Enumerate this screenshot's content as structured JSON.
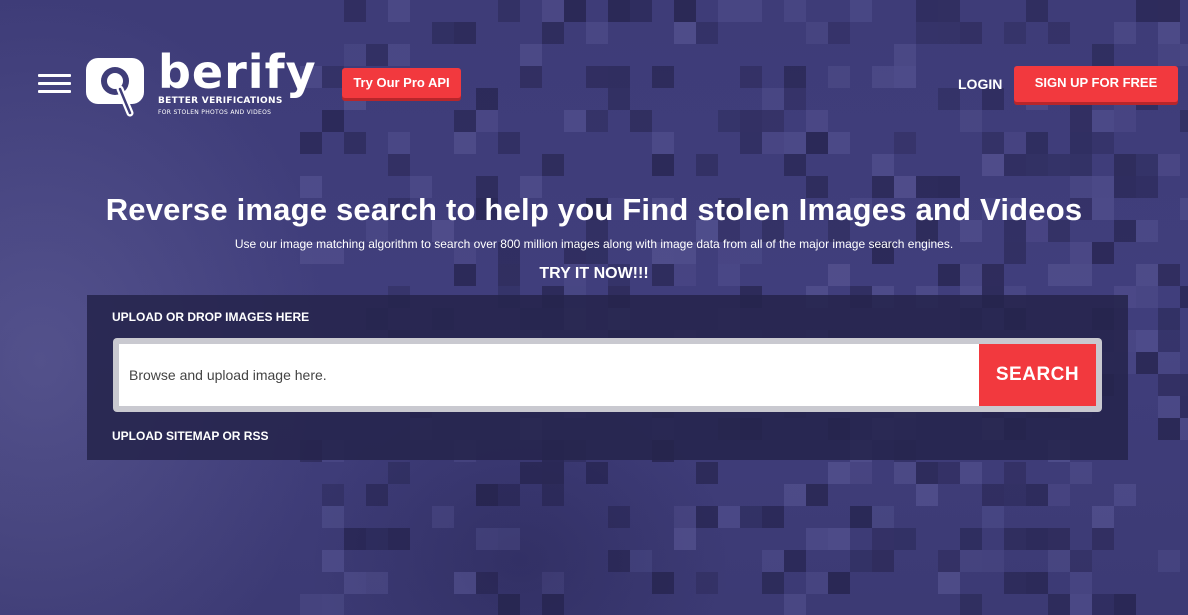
{
  "header": {
    "logo_word": "berify",
    "logo_tagline": "BETTER VERIFICATIONS",
    "logo_subtagline": "FOR STOLEN PHOTOS AND VIDEOS",
    "pro_api_label": "Try Our Pro API",
    "login_label": "LOGIN",
    "signup_label": "SIGN UP FOR FREE"
  },
  "hero": {
    "title": "Reverse image search to help you Find stolen Images and Videos",
    "subtitle": "Use our image matching algorithm to search over 800 million images along with image data from all of the major image search engines.",
    "cta": "TRY IT NOW!!!"
  },
  "upload": {
    "drop_label": "UPLOAD OR DROP IMAGES HERE",
    "input_placeholder": "Browse and upload image here.",
    "search_label": "SEARCH",
    "sitemap_label": "UPLOAD SITEMAP OR RSS"
  },
  "colors": {
    "background": "#3f3d78",
    "accent": "#f2393e",
    "panel": "#26244c"
  },
  "icons": [
    "hamburger-menu-icon",
    "magnifier-logo-icon"
  ]
}
